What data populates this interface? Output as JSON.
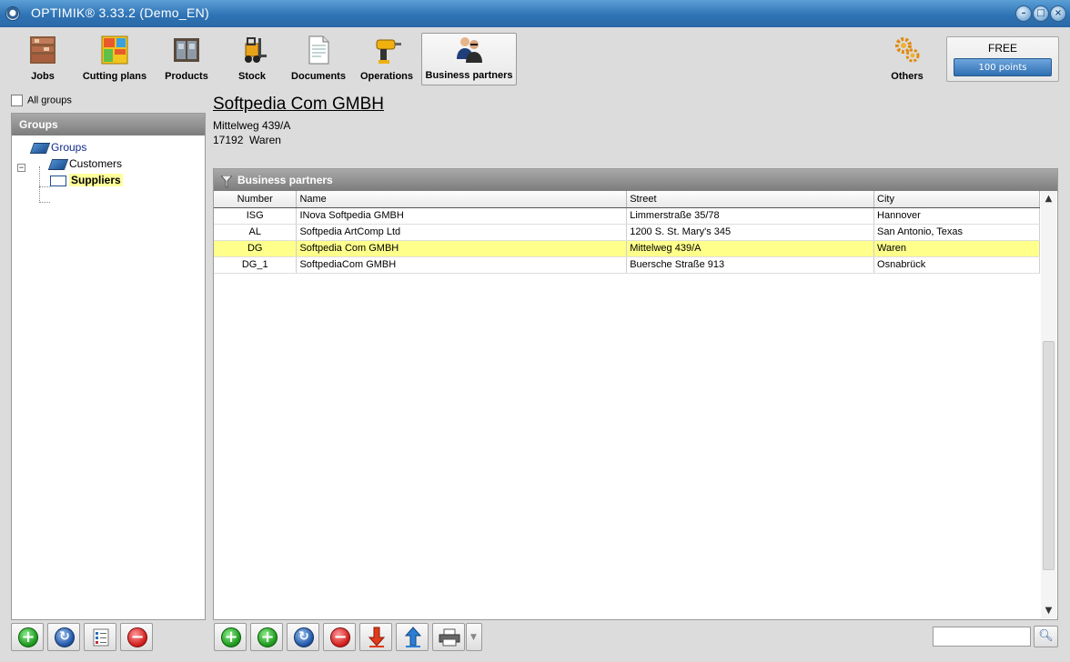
{
  "window": {
    "title": "OPTIMIK® 3.33.2  (Demo_EN)"
  },
  "toolbar": {
    "items": [
      {
        "label": "Jobs",
        "icon": "shelves-icon"
      },
      {
        "label": "Cutting plans",
        "icon": "cutting-plan-icon"
      },
      {
        "label": "Products",
        "icon": "products-icon"
      },
      {
        "label": "Stock",
        "icon": "forklift-icon"
      },
      {
        "label": "Documents",
        "icon": "document-icon"
      },
      {
        "label": "Operations",
        "icon": "drill-icon"
      },
      {
        "label": "Business partners",
        "icon": "people-icon",
        "active": true
      }
    ],
    "others_label": "Others",
    "license": {
      "label": "FREE",
      "points": "100 points"
    }
  },
  "left": {
    "all_groups_label": "All groups",
    "panel_title": "Groups",
    "tree": {
      "root": "Groups",
      "children": [
        "Customers",
        "Suppliers"
      ],
      "selected": "Suppliers"
    }
  },
  "partner": {
    "name": "Softpedia Com GMBH",
    "street": "Mittelweg 439/A",
    "zip": "17192",
    "city": "Waren"
  },
  "grid": {
    "title": "Business partners",
    "columns": [
      "Number",
      "Name",
      "Street",
      "City"
    ],
    "rows": [
      {
        "number": "ISG",
        "name": "INova Softpedia GMBH",
        "street": "Limmerstraße 35/78",
        "city": "Hannover"
      },
      {
        "number": "AL",
        "name": "Softpedia ArtComp Ltd",
        "street": "1200 S. St. Mary's 345",
        "city": "San Antonio, Texas"
      },
      {
        "number": "DG",
        "name": "Softpedia Com GMBH",
        "street": "Mittelweg 439/A",
        "city": "Waren",
        "selected": true
      },
      {
        "number": "DG_1",
        "name": "SoftpediaCom GMBH",
        "street": "Buersche Straße 913",
        "city": "Osnabrück"
      }
    ]
  },
  "search": {
    "value": ""
  },
  "colors": {
    "titlebar": "#2f74b5",
    "selection": "#ffff8c",
    "panel_header": "#7c7c7c"
  }
}
